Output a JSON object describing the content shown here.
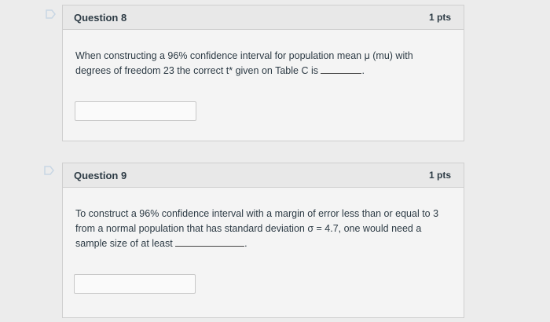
{
  "questions": [
    {
      "title": "Question 8",
      "points": "1 pts",
      "text_before_blank": "When constructing a 96% confidence interval for population mean μ (mu) with degrees of freedom 23 the correct t* given on Table C is",
      "text_after_blank": ".",
      "answer_value": ""
    },
    {
      "title": "Question 9",
      "points": "1 pts",
      "text_before_blank": "To construct a 96% confidence interval with a margin of error less than or equal to 3 from a normal population that has standard deviation σ = 4.7, one would need a sample size of at least",
      "text_after_blank": ".",
      "answer_value": ""
    }
  ]
}
